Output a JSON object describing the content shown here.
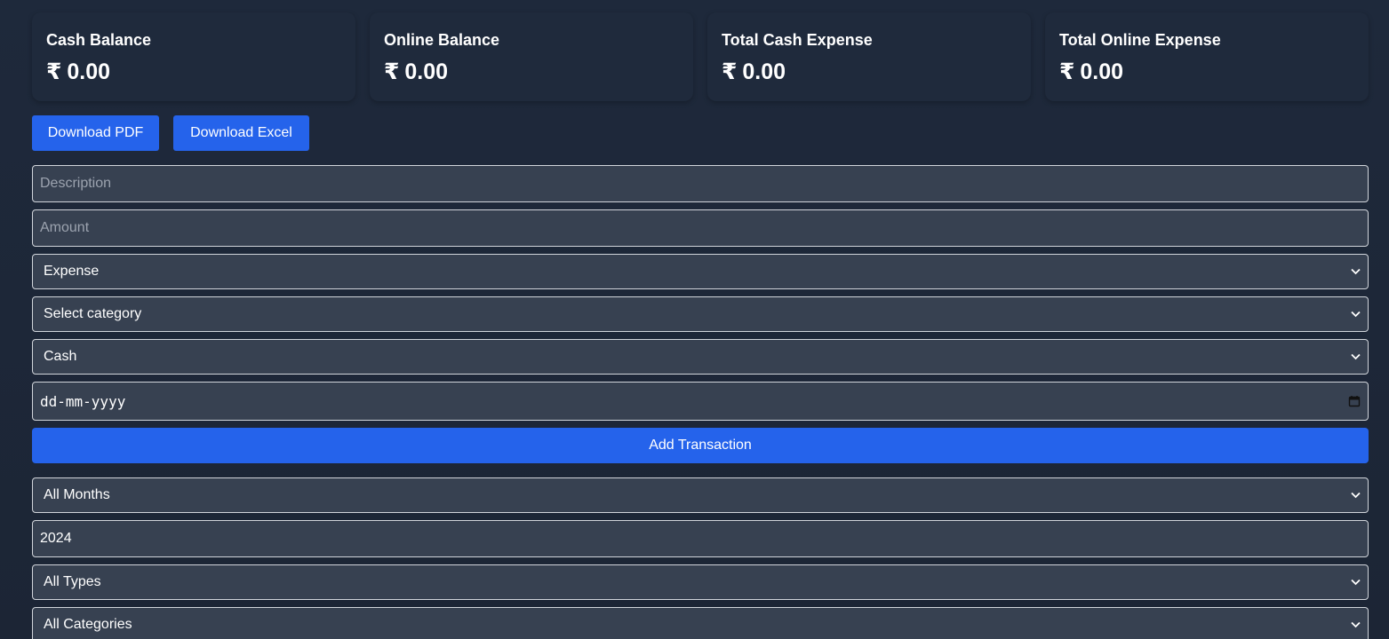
{
  "cards": [
    {
      "title": "Cash Balance",
      "currency": "₹",
      "value": "0.00"
    },
    {
      "title": "Online Balance",
      "currency": "₹",
      "value": "0.00"
    },
    {
      "title": "Total Cash Expense",
      "currency": "₹",
      "value": "0.00"
    },
    {
      "title": "Total Online Expense",
      "currency": "₹",
      "value": "0.00"
    }
  ],
  "actions": {
    "download_pdf": "Download PDF",
    "download_excel": "Download Excel"
  },
  "form": {
    "description_placeholder": "Description",
    "amount_placeholder": "Amount",
    "type_selected": "Expense",
    "category_selected": "Select category",
    "payment_selected": "Cash",
    "date_placeholder": "dd-mm-yyyy",
    "submit_label": "Add Transaction"
  },
  "filters": {
    "month_selected": "All Months",
    "year_value": "2024",
    "type_selected": "All Types",
    "category_selected": "All Categories"
  },
  "colors": {
    "accent": "#2563eb",
    "field_bg": "#374151",
    "card_bg": "#1f2a3c",
    "page_bg": "#1e293b"
  }
}
